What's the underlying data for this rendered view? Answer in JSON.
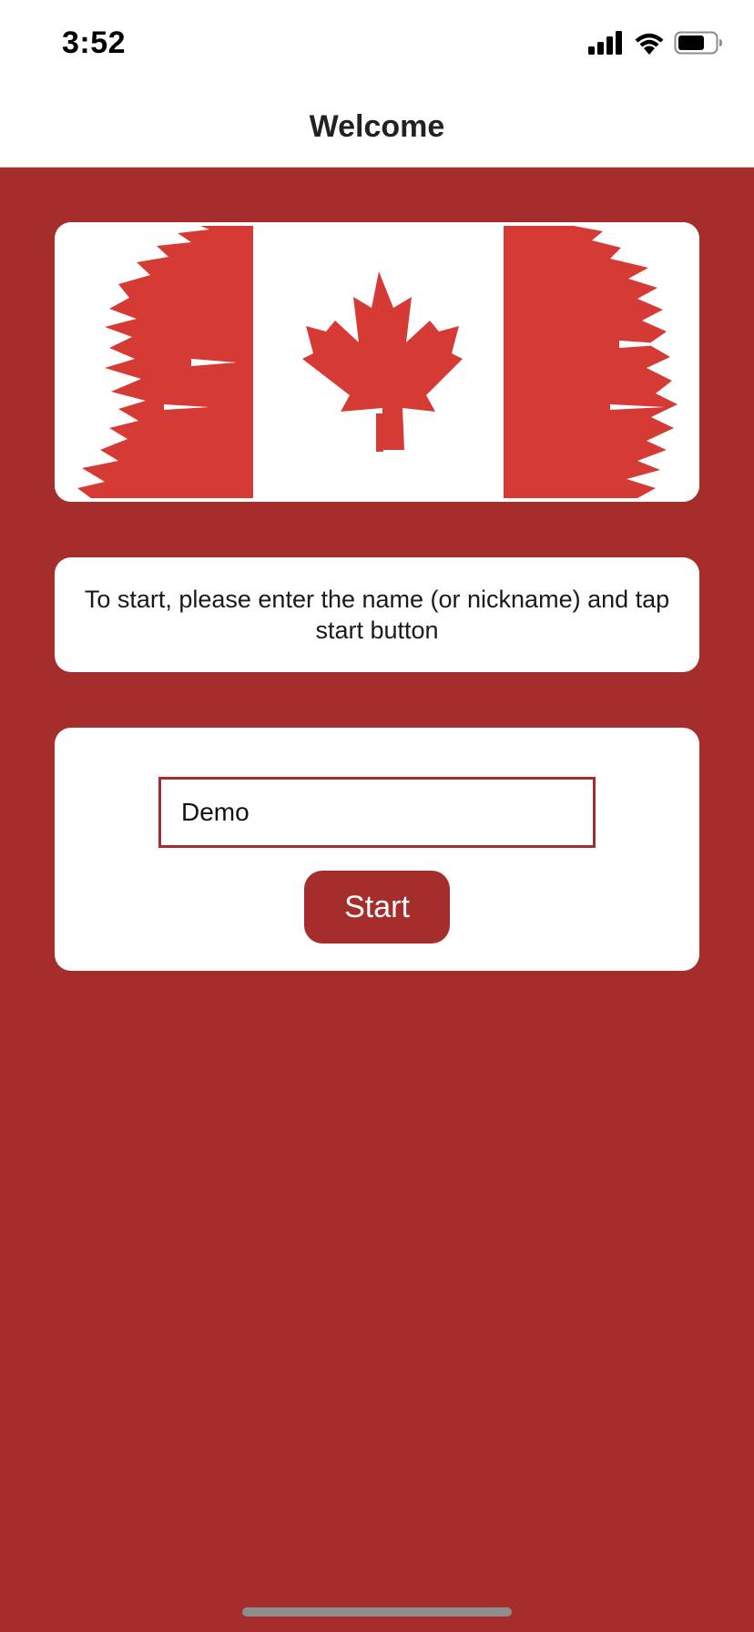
{
  "status_bar": {
    "time": "3:52",
    "icons": [
      "cellular-signal-icon",
      "wifi-icon",
      "battery-icon"
    ]
  },
  "nav": {
    "title": "Welcome"
  },
  "flag_image": {
    "depicts": "canada-flag-brush-style",
    "colors": {
      "red": "#d63a35",
      "white": "#ffffff"
    }
  },
  "instructions": {
    "text": "To start, please enter the name (or nickname) and tap start button"
  },
  "form": {
    "name_value": "Demo",
    "start_label": "Start"
  },
  "theme": {
    "background": "#a52d2b",
    "accent": "#a52d2b",
    "card": "#ffffff"
  }
}
